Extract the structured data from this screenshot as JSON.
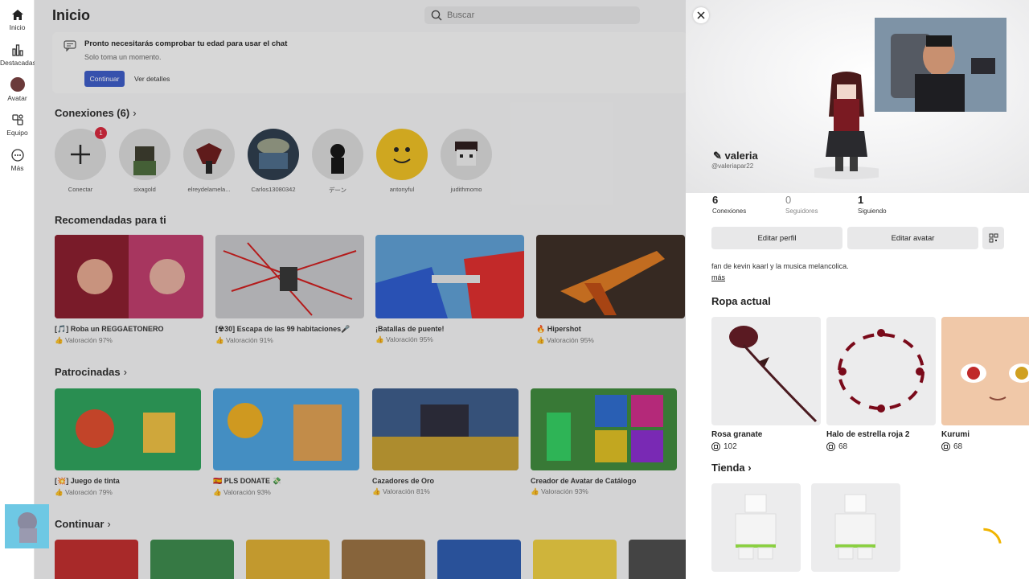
{
  "nav": {
    "items": [
      {
        "label": "Inicio",
        "icon": "home-icon"
      },
      {
        "label": "Destacadas",
        "icon": "chart-icon"
      },
      {
        "label": "Avatar",
        "icon": "avatar-icon"
      },
      {
        "label": "Equipo",
        "icon": "team-icon"
      },
      {
        "label": "Más",
        "icon": "more-icon"
      }
    ]
  },
  "header": {
    "title": "Inicio",
    "search_placeholder": "Buscar"
  },
  "notice": {
    "title": "Pronto necesitarás comprobar tu edad para usar el chat",
    "subtitle": "Solo toma un momento.",
    "primary": "Continuar",
    "secondary": "Ver detalles"
  },
  "connections": {
    "title": "Conexiones (6)",
    "badge": "1",
    "items": [
      {
        "name": "Conectar"
      },
      {
        "name": "sixagold"
      },
      {
        "name": "elreydelamela..."
      },
      {
        "name": "Carlos13080342"
      },
      {
        "name": "デーン"
      },
      {
        "name": "antonyful"
      },
      {
        "name": "judithmomo"
      }
    ]
  },
  "recommended": {
    "title": "Recomendadas para ti",
    "items": [
      {
        "title": "[🎵] Roba un REGGAETONERO",
        "rating": "Valoración 97%",
        "color": "#b02a3a"
      },
      {
        "title": "[☢30] Escapa de las 99 habitaciones🎤",
        "rating": "Valoración 91%",
        "color": "#c9c9cc"
      },
      {
        "title": "¡Batallas de puente!",
        "rating": "Valoración 95%",
        "color": "#5c9fd6"
      },
      {
        "title": "🔥 Hipershot",
        "rating": "Valoración 95%",
        "color": "#3a2a22"
      }
    ]
  },
  "sponsored": {
    "title": "Patrocinadas",
    "items": [
      {
        "title": "[💥] Juego de tinta",
        "rating": "Valoración 79%",
        "color": "#2aa25a"
      },
      {
        "title": "🇪🇸 PLS DONATE 💸",
        "rating": "Valoración 93%",
        "color": "#4aa3e0"
      },
      {
        "title": "Cazadores de Oro",
        "rating": "Valoración 81%",
        "color": "#3a5a8a"
      },
      {
        "title": "Creador de Avatar de Catálogo",
        "rating": "Valoración 93%",
        "color": "#3c8a3a"
      }
    ]
  },
  "continue": {
    "title": "Continuar",
    "colors": [
      "#c22a2a",
      "#3a8a4a",
      "#e0b030",
      "#9a7040",
      "#2a5ab0",
      "#f0d040",
      "#4a4a4a"
    ]
  },
  "profile": {
    "name": "valeria",
    "handle": "@valeriapar22",
    "stats": [
      {
        "num": "6",
        "label": "Conexiones"
      },
      {
        "num": "0",
        "label": "Seguidores"
      },
      {
        "num": "1",
        "label": "Siguiendo"
      }
    ],
    "edit_profile": "Editar perfil",
    "edit_avatar": "Editar avatar",
    "bio": "fan de kevin kaarl y la musica melancolica.",
    "more": "más",
    "outfit_title": "Ropa actual",
    "outfit": [
      {
        "name": "Rosa granate",
        "price": "102"
      },
      {
        "name": "Halo de estrella roja 2",
        "price": "68"
      },
      {
        "name": "Kurumi",
        "price": "68"
      }
    ],
    "shop_title": "Tienda"
  }
}
